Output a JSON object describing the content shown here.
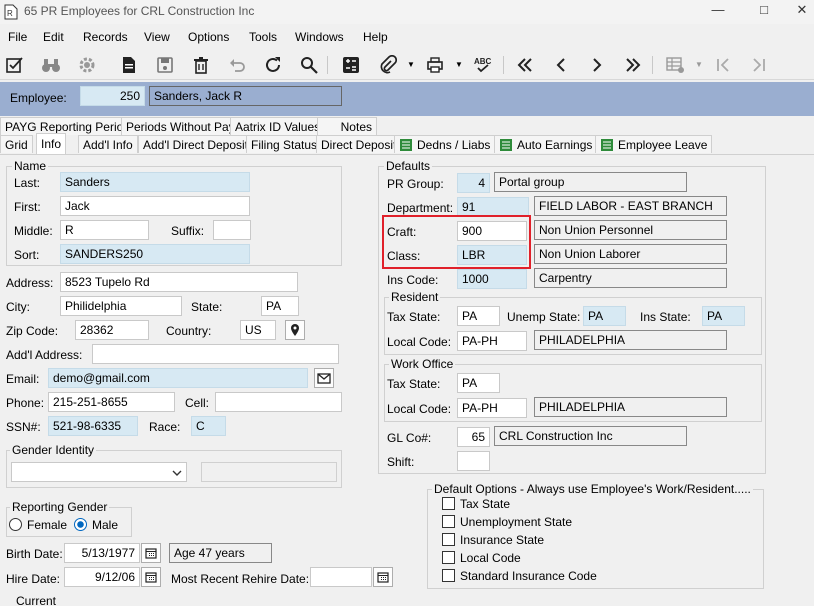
{
  "window": {
    "title": "65 PR Employees for CRL Construction Inc",
    "app_icon": "document-icon"
  },
  "menu": [
    "File",
    "Edit",
    "Records",
    "View",
    "Options",
    "Tools",
    "Windows",
    "Help"
  ],
  "employee": {
    "label": "Employee:",
    "number": "250",
    "name": "Sanders, Jack R"
  },
  "tabs_row1": [
    "PAYG Reporting Periods",
    "Periods Without Pay",
    "Aatrix ID Values",
    "Notes"
  ],
  "tabs_row2": [
    "Grid",
    "Info",
    "Add'l Info",
    "Add'l Direct Deposits",
    "Filing Status",
    "Direct Deposit",
    "Dedns / Liabs",
    "Auto Earnings",
    "Employee Leave"
  ],
  "name_group": {
    "label": "Name",
    "last_label": "Last:",
    "last": "Sanders",
    "first_label": "First:",
    "first": "Jack",
    "middle_label": "Middle:",
    "middle": "R",
    "suffix_label": "Suffix:",
    "suffix": "",
    "sort_label": "Sort:",
    "sort": "SANDERS250"
  },
  "address": {
    "address_label": "Address:",
    "address": "8523 Tupelo Rd",
    "city_label": "City:",
    "city": "Philidelphia",
    "state_label": "State:",
    "state": "PA",
    "zip_label": "Zip Code:",
    "zip": "28362",
    "country_label": "Country:",
    "country": "US",
    "addl_label": "Add'l Address:",
    "addl": ""
  },
  "contact": {
    "email_label": "Email:",
    "email": "demo@gmail.com",
    "phone_label": "Phone:",
    "phone": "215-251-8655",
    "cell_label": "Cell:",
    "cell": "",
    "ssn_label": "SSN#:",
    "ssn": "521-98-6335",
    "race_label": "Race:",
    "race": "C"
  },
  "gender_identity": {
    "label": "Gender Identity",
    "value": ""
  },
  "reporting_gender": {
    "label": "Reporting Gender",
    "female": "Female",
    "male": "Male",
    "selected": "Male"
  },
  "dates": {
    "birth_label": "Birth Date:",
    "birth": "5/13/1977",
    "age": "Age 47 years",
    "hire_label": "Hire Date:",
    "hire": "9/12/06",
    "rehire_label": "Most Recent Rehire Date:",
    "rehire": "",
    "current_label": "Current"
  },
  "defaults": {
    "label": "Defaults",
    "pr_group_label": "PR Group:",
    "pr_group": "4",
    "pr_group_desc": "Portal group",
    "department_label": "Department:",
    "department": "91",
    "department_desc": "FIELD LABOR - EAST BRANCH",
    "craft_label": "Craft:",
    "craft": "900",
    "craft_desc": "Non Union Personnel",
    "class_label": "Class:",
    "class": "LBR",
    "class_desc": "Non Union Laborer",
    "ins_label": "Ins Code:",
    "ins": "1000",
    "ins_desc": "Carpentry"
  },
  "resident": {
    "label": "Resident",
    "tax_state_label": "Tax State:",
    "tax_state": "PA",
    "unemp_label": "Unemp State:",
    "unemp": "PA",
    "ins_state_label": "Ins State:",
    "ins_state": "PA",
    "local_label": "Local Code:",
    "local": "PA-PH",
    "local_desc": "PHILADELPHIA"
  },
  "work_office": {
    "label": "Work Office",
    "tax_state_label": "Tax State:",
    "tax_state": "PA",
    "local_label": "Local Code:",
    "local": "PA-PH",
    "local_desc": "PHILADELPHIA"
  },
  "gl": {
    "label": "GL Co#:",
    "value": "65",
    "desc": "CRL Construction Inc",
    "shift_label": "Shift:",
    "shift": ""
  },
  "default_options": {
    "label": "Default Options - Always use Employee's Work/Resident.....",
    "items": [
      "Tax State",
      "Unemployment State",
      "Insurance State",
      "Local Code",
      "Standard Insurance Code"
    ]
  },
  "colors": {
    "employee_bar": "#9aaed0",
    "highlight": "#e0202a",
    "blue_field": "#d7e9f3"
  }
}
